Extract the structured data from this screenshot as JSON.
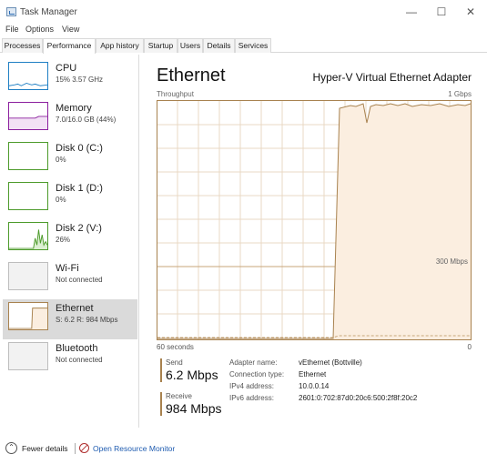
{
  "window": {
    "title": "Task Manager"
  },
  "menu": [
    "File",
    "Options",
    "View"
  ],
  "tabs": [
    "Processes",
    "Performance",
    "App history",
    "Startup",
    "Users",
    "Details",
    "Services"
  ],
  "sidebar": [
    {
      "name": "CPU",
      "sub": "15% 3.57 GHz",
      "color": "#1f7fc4"
    },
    {
      "name": "Memory",
      "sub": "7.0/16.0 GB (44%)",
      "color": "#8b1f9e"
    },
    {
      "name": "Disk 0 (C:)",
      "sub": "0%",
      "color": "#4d9b2b"
    },
    {
      "name": "Disk 1 (D:)",
      "sub": "0%",
      "color": "#4d9b2b"
    },
    {
      "name": "Disk 2 (V:)",
      "sub": "26%",
      "color": "#4d9b2b"
    },
    {
      "name": "Wi-Fi",
      "sub": "Not connected",
      "color": "#bdbdbd"
    },
    {
      "name": "Ethernet",
      "sub": "S: 6.2  R: 984 Mbps",
      "color": "#a8824f"
    },
    {
      "name": "Bluetooth",
      "sub": "Not connected",
      "color": "#bdbdbd"
    }
  ],
  "main": {
    "title": "Ethernet",
    "adapter": "Hyper-V Virtual Ethernet Adapter",
    "throughput_label": "Throughput",
    "max_label": "1 Gbps",
    "mid_label": "300 Mbps",
    "time_left": "60 seconds",
    "time_right": "0",
    "accent": "#a8824f",
    "fill": "#fbeee0"
  },
  "send": {
    "label": "Send",
    "value": "6.2 Mbps"
  },
  "receive": {
    "label": "Receive",
    "value": "984 Mbps"
  },
  "details": [
    {
      "key": "Adapter name:",
      "value": "vEthernet (Bottville)"
    },
    {
      "key": "Connection type:",
      "value": "Ethernet"
    },
    {
      "key": "IPv4 address:",
      "value": "10.0.0.14"
    },
    {
      "key": "IPv6 address:",
      "value": "2601:0:702:87d0:20c6:500:2f8f:20c2"
    }
  ],
  "footer": {
    "fewer": "Fewer details",
    "resource_monitor": "Open Resource Monitor"
  }
}
